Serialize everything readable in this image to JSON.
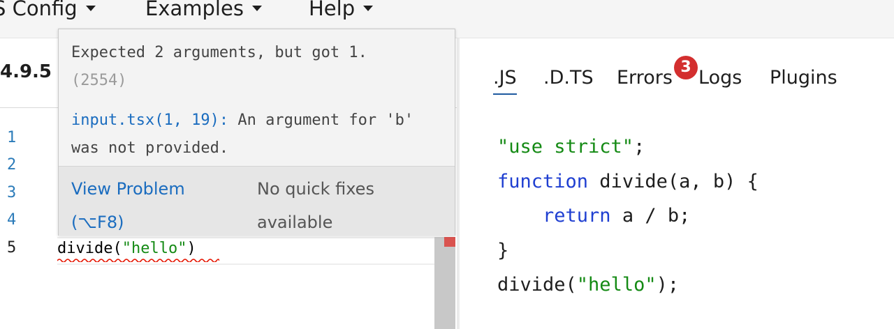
{
  "nav": {
    "items": [
      {
        "label": "S Config"
      },
      {
        "label": "Examples"
      },
      {
        "label": "Help"
      }
    ]
  },
  "editor": {
    "version": "4.9.5",
    "line_numbers": [
      "1",
      "2",
      "3",
      "4",
      "5"
    ],
    "line5": {
      "fn": "divide(",
      "arg": "\"hello\"",
      "close": ")"
    }
  },
  "tooltip": {
    "message": "Expected 2 arguments, but got 1.",
    "error_code": "(2554)",
    "source_link": "input.tsx(1, 19):",
    "source_text": " An argument for 'b' was not provided.",
    "view_problem": "View Problem (⌥F8)",
    "no_fixes": "No quick fixes available"
  },
  "output": {
    "tabs": [
      ".JS",
      ".D.TS",
      "Errors",
      "Logs",
      "Plugins"
    ],
    "active_tab": ".JS",
    "errors_count": "3",
    "code": {
      "l1_str": "\"use strict\"",
      "l1_end": ";",
      "l2_kw": "function",
      "l2_rest": " divide(a, b) {",
      "l3_indent": "    ",
      "l3_kw": "return",
      "l3_rest": " a / b;",
      "l4": "}",
      "l5_fn": "divide(",
      "l5_str": "\"hello\"",
      "l5_end": ");"
    }
  },
  "colors": {
    "link": "#1a6cbf",
    "keyword": "#1f3fd1",
    "string": "#148a14",
    "badge": "#d32f2f"
  }
}
